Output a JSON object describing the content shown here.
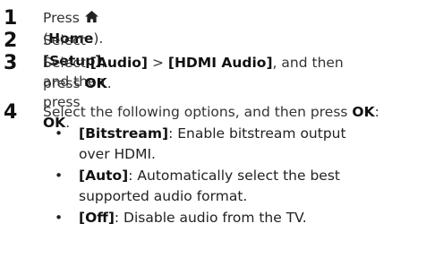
{
  "steps": [
    {
      "number": "1",
      "pre": "Press ",
      "icon": "home-icon",
      "mid": " (",
      "bold": "Home",
      "post": ")."
    },
    {
      "number": "2",
      "pre": "Select ",
      "bold1": "[Setup]",
      "mid": ", and then press ",
      "bold2": "OK",
      "post": "."
    },
    {
      "number": "3",
      "pre": "Select ",
      "bold1": "[Audio]",
      "mid": " > ",
      "bold2": "[HDMI Audio]",
      "post": ", and then",
      "line2pre": "press ",
      "line2bold": "OK",
      "line2post": "."
    },
    {
      "number": "4",
      "pre": "Select the following options, and then press ",
      "bold": "OK",
      "post": ":"
    }
  ],
  "options": [
    {
      "bullet": "•",
      "label": "[Bitstream]",
      "desc1": ": Enable bitstream output",
      "desc2": "over HDMI."
    },
    {
      "bullet": "•",
      "label": "[Auto]",
      "desc1": ": Automatically select the best",
      "desc2": "supported audio format."
    },
    {
      "bullet": "•",
      "label": "[Off]",
      "desc1": ": Disable audio from the TV.",
      "desc2": ""
    }
  ]
}
